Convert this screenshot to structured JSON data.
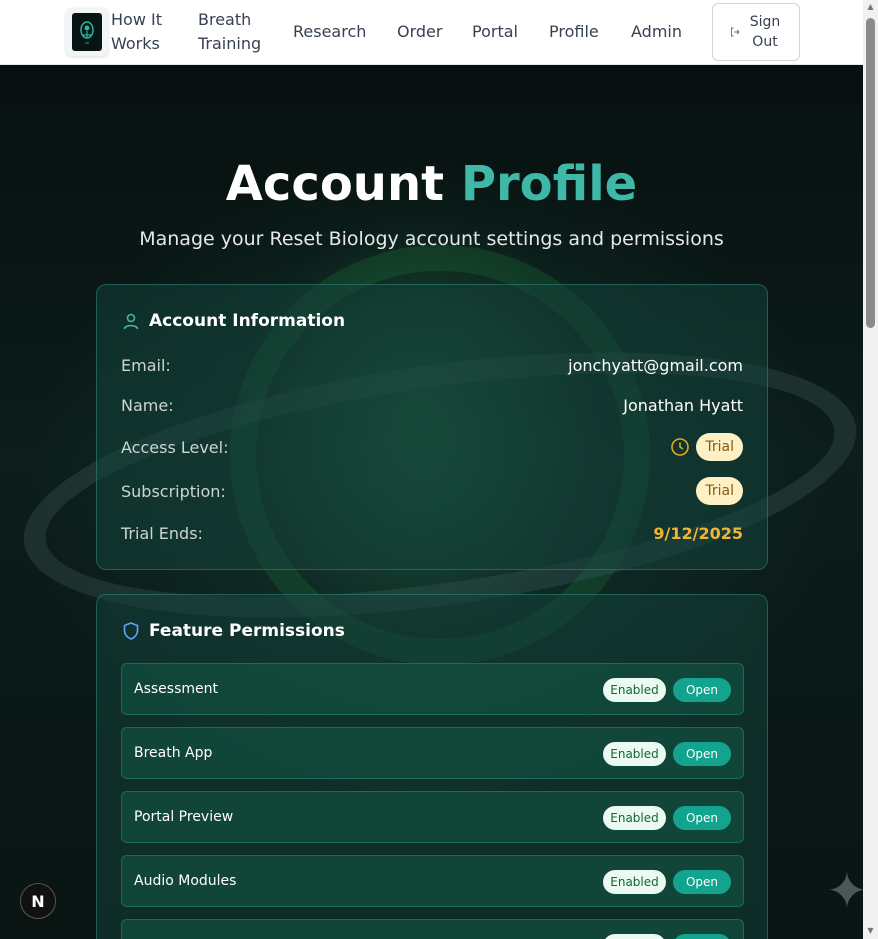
{
  "nav": {
    "links": [
      "How It Works",
      "Breath Training",
      "Research",
      "Order",
      "Portal",
      "Profile",
      "Admin"
    ],
    "sign_out": "Sign Out"
  },
  "hero": {
    "title_main": "Account",
    "title_accent": "Profile",
    "subtitle": "Manage your Reset Biology account settings and permissions"
  },
  "account": {
    "heading": "Account Information",
    "email_label": "Email:",
    "email": "jonchyatt@gmail.com",
    "name_label": "Name:",
    "name": "Jonathan Hyatt",
    "access_label": "Access Level:",
    "access_value": "Trial",
    "subscription_label": "Subscription:",
    "subscription_value": "Trial",
    "trial_ends_label": "Trial Ends:",
    "trial_ends": "9/12/2025"
  },
  "permissions": {
    "heading": "Feature Permissions",
    "enabled_label": "Enabled",
    "open_label": "Open",
    "items": [
      "Assessment",
      "Breath App",
      "Portal Preview",
      "Audio Modules"
    ]
  },
  "dev_badge": "N",
  "colors": {
    "accent": "#3fb8a8",
    "open_button": "#14a38f",
    "trial_badge": "#fdf0c4",
    "trial_date": "#f2b431"
  }
}
